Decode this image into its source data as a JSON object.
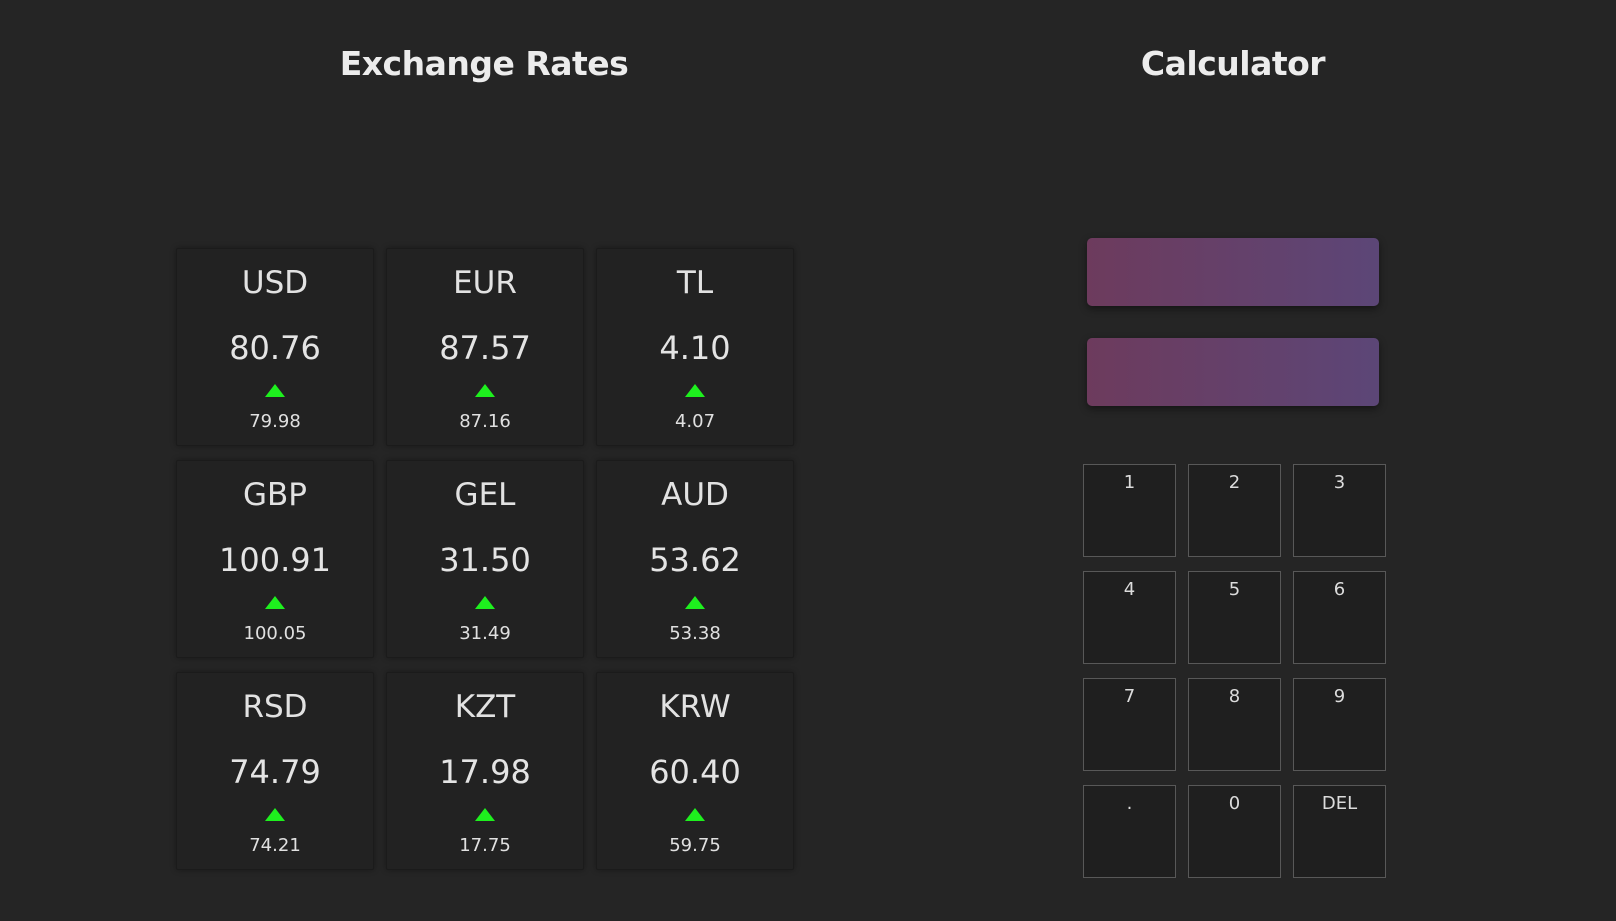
{
  "rates_section": {
    "title": "Exchange Rates",
    "cards": [
      {
        "code": "USD",
        "value": "80.76",
        "trend": "up",
        "previous": "79.98"
      },
      {
        "code": "EUR",
        "value": "87.57",
        "trend": "up",
        "previous": "87.16"
      },
      {
        "code": "TL",
        "value": "4.10",
        "trend": "up",
        "previous": "4.07"
      },
      {
        "code": "GBP",
        "value": "100.91",
        "trend": "up",
        "previous": "100.05"
      },
      {
        "code": "GEL",
        "value": "31.50",
        "trend": "up",
        "previous": "31.49"
      },
      {
        "code": "AUD",
        "value": "53.62",
        "trend": "up",
        "previous": "53.38"
      },
      {
        "code": "RSD",
        "value": "74.79",
        "trend": "up",
        "previous": "74.21"
      },
      {
        "code": "KZT",
        "value": "17.98",
        "trend": "up",
        "previous": "17.75"
      },
      {
        "code": "KRW",
        "value": "60.40",
        "trend": "up",
        "previous": "59.75"
      }
    ],
    "trend_icon": "triangle-up-icon",
    "trend_color": "#1ef01e"
  },
  "calculator": {
    "title": "Calculator",
    "display_top": "",
    "display_bottom": "",
    "display_gradient": [
      "#6d3b5d",
      "#5c4677"
    ],
    "keys": [
      "1",
      "2",
      "3",
      "4",
      "5",
      "6",
      "7",
      "8",
      "9",
      ".",
      "0",
      "DEL"
    ]
  },
  "colors": {
    "background": "#252525",
    "card_background": "#222222",
    "key_border": "#585858"
  }
}
